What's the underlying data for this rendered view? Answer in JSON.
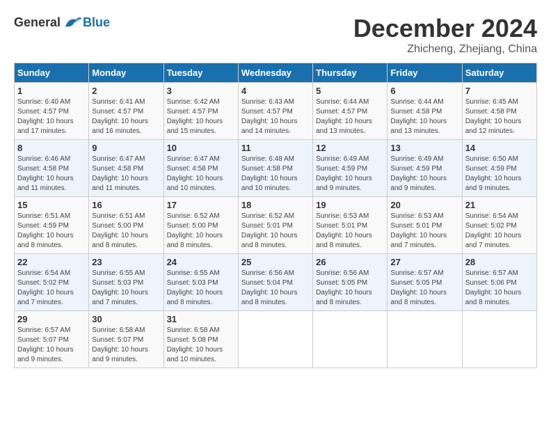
{
  "logo": {
    "general": "General",
    "blue": "Blue"
  },
  "title": {
    "month": "December 2024",
    "location": "Zhicheng, Zhejiang, China"
  },
  "weekdays": [
    "Sunday",
    "Monday",
    "Tuesday",
    "Wednesday",
    "Thursday",
    "Friday",
    "Saturday"
  ],
  "weeks": [
    [
      {
        "day": "1",
        "info": "Sunrise: 6:40 AM\nSunset: 4:57 PM\nDaylight: 10 hours\nand 17 minutes."
      },
      {
        "day": "2",
        "info": "Sunrise: 6:41 AM\nSunset: 4:57 PM\nDaylight: 10 hours\nand 16 minutes."
      },
      {
        "day": "3",
        "info": "Sunrise: 6:42 AM\nSunset: 4:57 PM\nDaylight: 10 hours\nand 15 minutes."
      },
      {
        "day": "4",
        "info": "Sunrise: 6:43 AM\nSunset: 4:57 PM\nDaylight: 10 hours\nand 14 minutes."
      },
      {
        "day": "5",
        "info": "Sunrise: 6:44 AM\nSunset: 4:57 PM\nDaylight: 10 hours\nand 13 minutes."
      },
      {
        "day": "6",
        "info": "Sunrise: 6:44 AM\nSunset: 4:58 PM\nDaylight: 10 hours\nand 13 minutes."
      },
      {
        "day": "7",
        "info": "Sunrise: 6:45 AM\nSunset: 4:58 PM\nDaylight: 10 hours\nand 12 minutes."
      }
    ],
    [
      {
        "day": "8",
        "info": "Sunrise: 6:46 AM\nSunset: 4:58 PM\nDaylight: 10 hours\nand 11 minutes."
      },
      {
        "day": "9",
        "info": "Sunrise: 6:47 AM\nSunset: 4:58 PM\nDaylight: 10 hours\nand 11 minutes."
      },
      {
        "day": "10",
        "info": "Sunrise: 6:47 AM\nSunset: 4:58 PM\nDaylight: 10 hours\nand 10 minutes."
      },
      {
        "day": "11",
        "info": "Sunrise: 6:48 AM\nSunset: 4:58 PM\nDaylight: 10 hours\nand 10 minutes."
      },
      {
        "day": "12",
        "info": "Sunrise: 6:49 AM\nSunset: 4:59 PM\nDaylight: 10 hours\nand 9 minutes."
      },
      {
        "day": "13",
        "info": "Sunrise: 6:49 AM\nSunset: 4:59 PM\nDaylight: 10 hours\nand 9 minutes."
      },
      {
        "day": "14",
        "info": "Sunrise: 6:50 AM\nSunset: 4:59 PM\nDaylight: 10 hours\nand 9 minutes."
      }
    ],
    [
      {
        "day": "15",
        "info": "Sunrise: 6:51 AM\nSunset: 4:59 PM\nDaylight: 10 hours\nand 8 minutes."
      },
      {
        "day": "16",
        "info": "Sunrise: 6:51 AM\nSunset: 5:00 PM\nDaylight: 10 hours\nand 8 minutes."
      },
      {
        "day": "17",
        "info": "Sunrise: 6:52 AM\nSunset: 5:00 PM\nDaylight: 10 hours\nand 8 minutes."
      },
      {
        "day": "18",
        "info": "Sunrise: 6:52 AM\nSunset: 5:01 PM\nDaylight: 10 hours\nand 8 minutes."
      },
      {
        "day": "19",
        "info": "Sunrise: 6:53 AM\nSunset: 5:01 PM\nDaylight: 10 hours\nand 8 minutes."
      },
      {
        "day": "20",
        "info": "Sunrise: 6:53 AM\nSunset: 5:01 PM\nDaylight: 10 hours\nand 7 minutes."
      },
      {
        "day": "21",
        "info": "Sunrise: 6:54 AM\nSunset: 5:02 PM\nDaylight: 10 hours\nand 7 minutes."
      }
    ],
    [
      {
        "day": "22",
        "info": "Sunrise: 6:54 AM\nSunset: 5:02 PM\nDaylight: 10 hours\nand 7 minutes."
      },
      {
        "day": "23",
        "info": "Sunrise: 6:55 AM\nSunset: 5:03 PM\nDaylight: 10 hours\nand 7 minutes."
      },
      {
        "day": "24",
        "info": "Sunrise: 6:55 AM\nSunset: 5:03 PM\nDaylight: 10 hours\nand 8 minutes."
      },
      {
        "day": "25",
        "info": "Sunrise: 6:56 AM\nSunset: 5:04 PM\nDaylight: 10 hours\nand 8 minutes."
      },
      {
        "day": "26",
        "info": "Sunrise: 6:56 AM\nSunset: 5:05 PM\nDaylight: 10 hours\nand 8 minutes."
      },
      {
        "day": "27",
        "info": "Sunrise: 6:57 AM\nSunset: 5:05 PM\nDaylight: 10 hours\nand 8 minutes."
      },
      {
        "day": "28",
        "info": "Sunrise: 6:57 AM\nSunset: 5:06 PM\nDaylight: 10 hours\nand 8 minutes."
      }
    ],
    [
      {
        "day": "29",
        "info": "Sunrise: 6:57 AM\nSunset: 5:07 PM\nDaylight: 10 hours\nand 9 minutes."
      },
      {
        "day": "30",
        "info": "Sunrise: 6:58 AM\nSunset: 5:07 PM\nDaylight: 10 hours\nand 9 minutes."
      },
      {
        "day": "31",
        "info": "Sunrise: 6:58 AM\nSunset: 5:08 PM\nDaylight: 10 hours\nand 10 minutes."
      },
      {
        "day": "",
        "info": ""
      },
      {
        "day": "",
        "info": ""
      },
      {
        "day": "",
        "info": ""
      },
      {
        "day": "",
        "info": ""
      }
    ]
  ]
}
